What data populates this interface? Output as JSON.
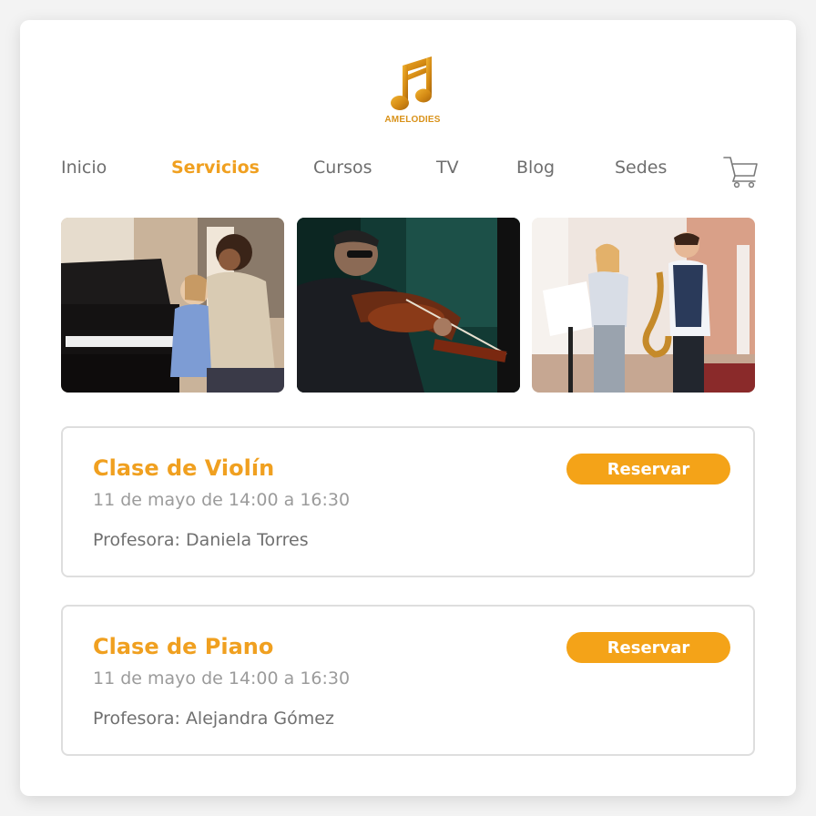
{
  "brand": {
    "logo_icon": "music-note-icon",
    "name": "AMELODIES"
  },
  "nav": {
    "items": [
      {
        "label": "Inicio",
        "active": false
      },
      {
        "label": "Servicios",
        "active": true
      },
      {
        "label": "Cursos",
        "active": false
      },
      {
        "label": "TV",
        "active": false
      },
      {
        "label": "Blog",
        "active": false
      },
      {
        "label": "Sedes",
        "active": false
      }
    ],
    "cart_icon": "cart-icon"
  },
  "gallery": [
    {
      "subject": "teacher with child at piano"
    },
    {
      "subject": "man playing violin"
    },
    {
      "subject": "teacher with boy playing saxophone"
    }
  ],
  "classes": [
    {
      "title": "Clase de Violín",
      "date": "11 de mayo de 14:00 a 16:30",
      "teacher": "Profesora: Daniela Torres",
      "button": "Reservar"
    },
    {
      "title": "Clase de Piano",
      "date": "11 de mayo de 14:00 a 16:30",
      "teacher": "Profesora: Alejandra Gómez",
      "button": "Reservar"
    }
  ],
  "colors": {
    "accent": "#f0a020",
    "button": "#f4a318",
    "text": "#6e6e6e",
    "muted": "#9b9b9b"
  }
}
